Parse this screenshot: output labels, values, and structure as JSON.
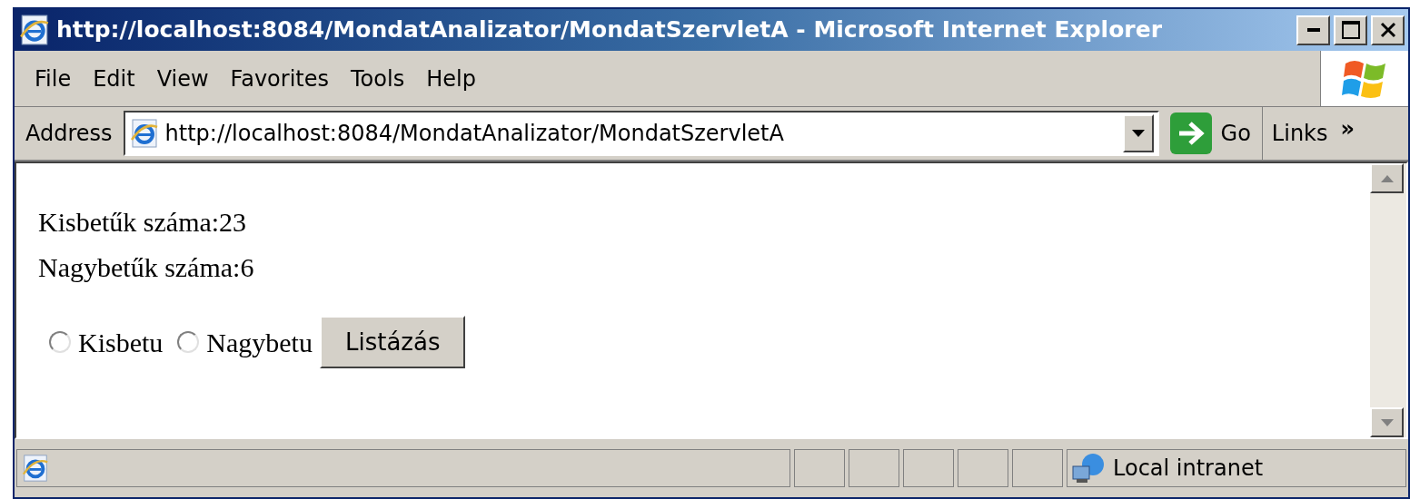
{
  "window": {
    "title": "http://localhost:8084/MondatAnalizator/MondatSzervletA - Microsoft Internet Explorer"
  },
  "menu": [
    "File",
    "Edit",
    "View",
    "Favorites",
    "Tools",
    "Help"
  ],
  "address_bar": {
    "label": "Address",
    "value": "http://localhost:8084/MondatAnalizator/MondatSzervletA",
    "go": "Go",
    "links": "Links",
    "more": "»"
  },
  "page": {
    "lines": [
      "Kisbetűk száma:23",
      "Nagybetűk száma:6"
    ],
    "radios": [
      {
        "label": "Kisbetu",
        "selected": false
      },
      {
        "label": "Nagybetu",
        "selected": false
      }
    ],
    "button": "Listázás"
  },
  "status_bar": {
    "zone": "Local intranet"
  }
}
